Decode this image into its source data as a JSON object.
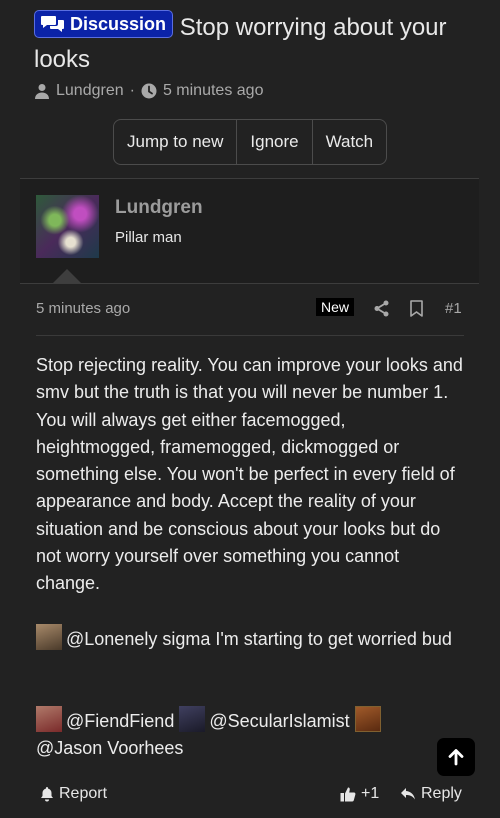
{
  "thread": {
    "prefix": "Discussion",
    "title": "Stop worrying about your looks",
    "author": "Lundgren",
    "separator": "·",
    "time": "5 minutes ago"
  },
  "actions": {
    "jump": "Jump to new",
    "ignore": "Ignore",
    "watch": "Watch"
  },
  "post": {
    "username": "Lundgren",
    "user_title": "Pillar man",
    "time": "5 minutes ago",
    "badge": "New",
    "number": "#1",
    "body": "Stop rejecting reality. You can improve your looks and smv but the truth is that you will never be number 1. You will always get either facemogged, heightmogged, framemogged, dickmogged or something else. You won't be perfect in every field of appearance and body. Accept the reality of your situation and be conscious about your looks but do not worry yourself over something you cannot change.",
    "mention1": "@Lonenely sigma I'm starting to get worried bud",
    "mention_fiend": "@FiendFiend",
    "mention_secular": "@SecularIslamist",
    "mention_jason": "@Jason Voorhees"
  },
  "footer": {
    "report": "Report",
    "like_count": "+1",
    "reply": "Reply"
  },
  "icons": {
    "prefix": "comments-icon",
    "user": "user-icon",
    "clock": "clock-icon",
    "share": "share-icon",
    "bookmark": "bookmark-icon",
    "report": "bell-icon",
    "like": "thumbs-up-icon",
    "reply": "reply-icon",
    "scroll": "arrow-up-icon"
  },
  "colors": {
    "background": "#222222",
    "prefix_badge": "#0b23a8",
    "username": "#9c9c9c"
  }
}
